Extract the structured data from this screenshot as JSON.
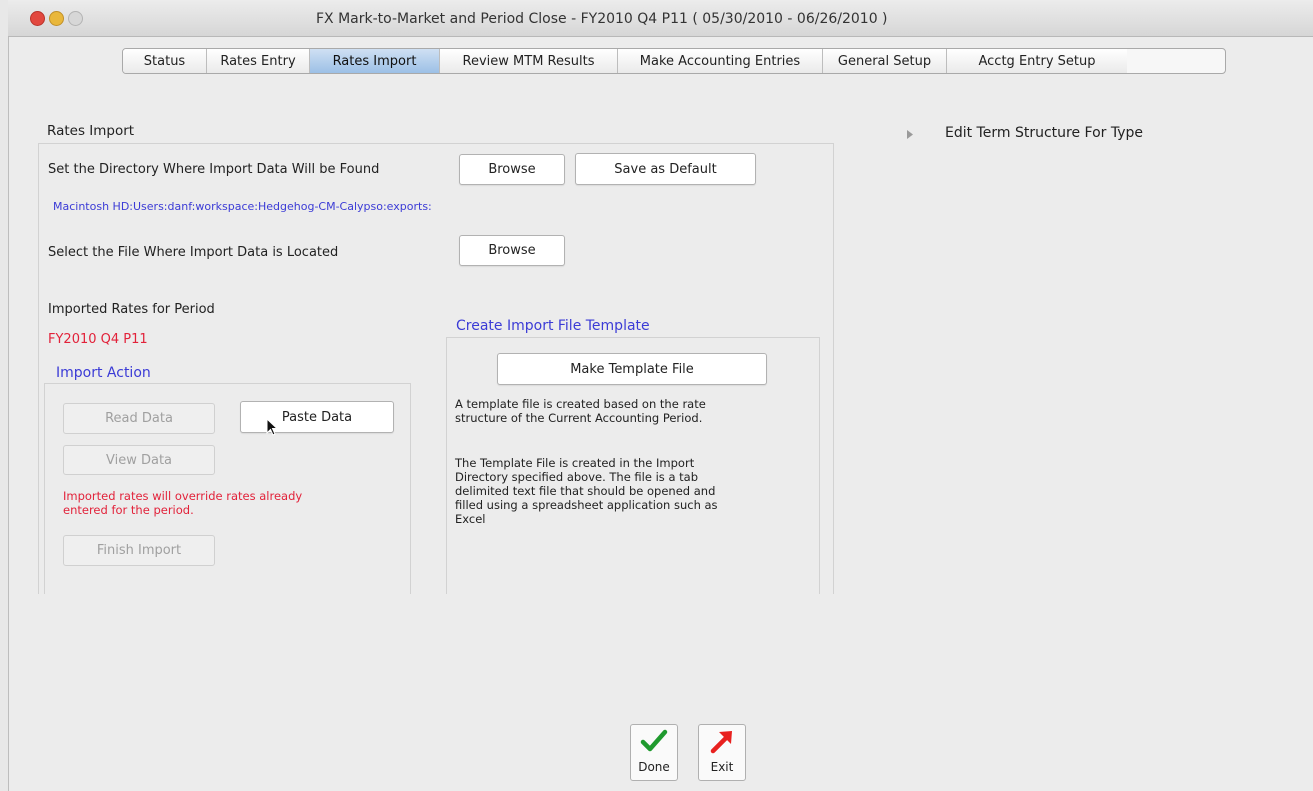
{
  "window": {
    "title": "FX Mark-to-Market and Period Close - FY2010 Q4 P11  ( 05/30/2010 - 06/26/2010 )"
  },
  "tabs": [
    {
      "label": "Status",
      "active": false
    },
    {
      "label": "Rates Entry",
      "active": false
    },
    {
      "label": "Rates Import",
      "active": true
    },
    {
      "label": "Review MTM Results",
      "active": false
    },
    {
      "label": "Make Accounting Entries",
      "active": false
    },
    {
      "label": "General Setup",
      "active": false
    },
    {
      "label": "Acctg Entry Setup",
      "active": false
    }
  ],
  "rates_import": {
    "group_label": "Rates Import",
    "set_directory_label": "Set the Directory Where Import Data Will be Found",
    "browse_label": "Browse",
    "save_default_label": "Save as Default",
    "directory_path": "Macintosh HD:Users:danf:workspace:Hedgehog-CM-Calypso:exports:",
    "select_file_label": "Select the File Where Import Data is Located",
    "browse_file_label": "Browse",
    "imported_rates_label": "Imported Rates for Period",
    "period_value": "FY2010 Q4 P11"
  },
  "import_action": {
    "group_label": "Import Action",
    "read_data_label": "Read Data",
    "paste_data_label": "Paste Data",
    "view_data_label": "View Data",
    "warning_text": "Imported rates will override rates already\nentered for the period.",
    "finish_import_label": "Finish Import"
  },
  "template": {
    "group_label": "Create Import File Template",
    "make_template_label": "Make Template File",
    "description_1": "A template file is created based on the rate\nstructure of the Current Accounting Period.",
    "description_2": "The Template File is created in the Import\nDirectory specified above.  The file is a tab\ndelimited text file that should be opened and\nfilled using a spreadsheet application such as\nExcel"
  },
  "term_structure": {
    "disclosure_label": "Edit Term Structure For Type"
  },
  "footer": {
    "done_label": "Done",
    "exit_label": "Exit"
  },
  "colors": {
    "blue_label": "#3b3bd6",
    "red_text": "#e2223a",
    "active_tab": "#9cc0e6"
  },
  "icons": {
    "done": "green-check-icon",
    "exit": "red-arrow-icon",
    "disclosure": "disclosure-triangle-icon"
  }
}
